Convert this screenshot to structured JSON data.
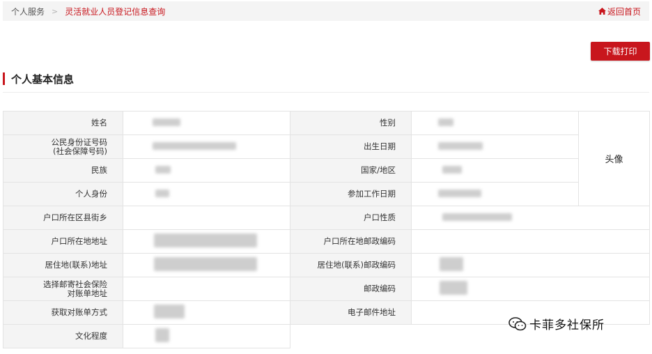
{
  "breadcrumb": {
    "home": "个人服务",
    "separator": ">",
    "current": "灵活就业人员登记信息查询",
    "home_link": "返回首页"
  },
  "toolbar": {
    "print_label": "下载打印"
  },
  "section": {
    "title": "个人基本信息"
  },
  "photo": {
    "label": "头像"
  },
  "fields": {
    "name": "姓名",
    "gender": "性别",
    "id_number_line1": "公民身份证号码",
    "id_number_line2": "(社会保障号码)",
    "birth_date": "出生日期",
    "ethnicity": "民族",
    "country": "国家/地区",
    "identity": "个人身份",
    "work_start_date": "参加工作日期",
    "household_district": "户口所在区县街乡",
    "household_type": "户口性质",
    "household_address": "户口所在地地址",
    "household_postcode": "户口所在地邮政编码",
    "residence_address": "居住地(联系)地址",
    "residence_postcode": "居住地(联系)邮政编码",
    "mail_address_line1": "选择邮寄社会保险",
    "mail_address_line2": "对账单地址",
    "postcode": "邮政编码",
    "statement_method": "获取对账单方式",
    "email": "电子邮件地址",
    "education": "文化程度"
  },
  "watermark": {
    "text": "卡菲多社保所"
  },
  "colors": {
    "accent": "#c8161d",
    "label_bg": "#f4f4f4",
    "border": "#e3e3e3"
  }
}
